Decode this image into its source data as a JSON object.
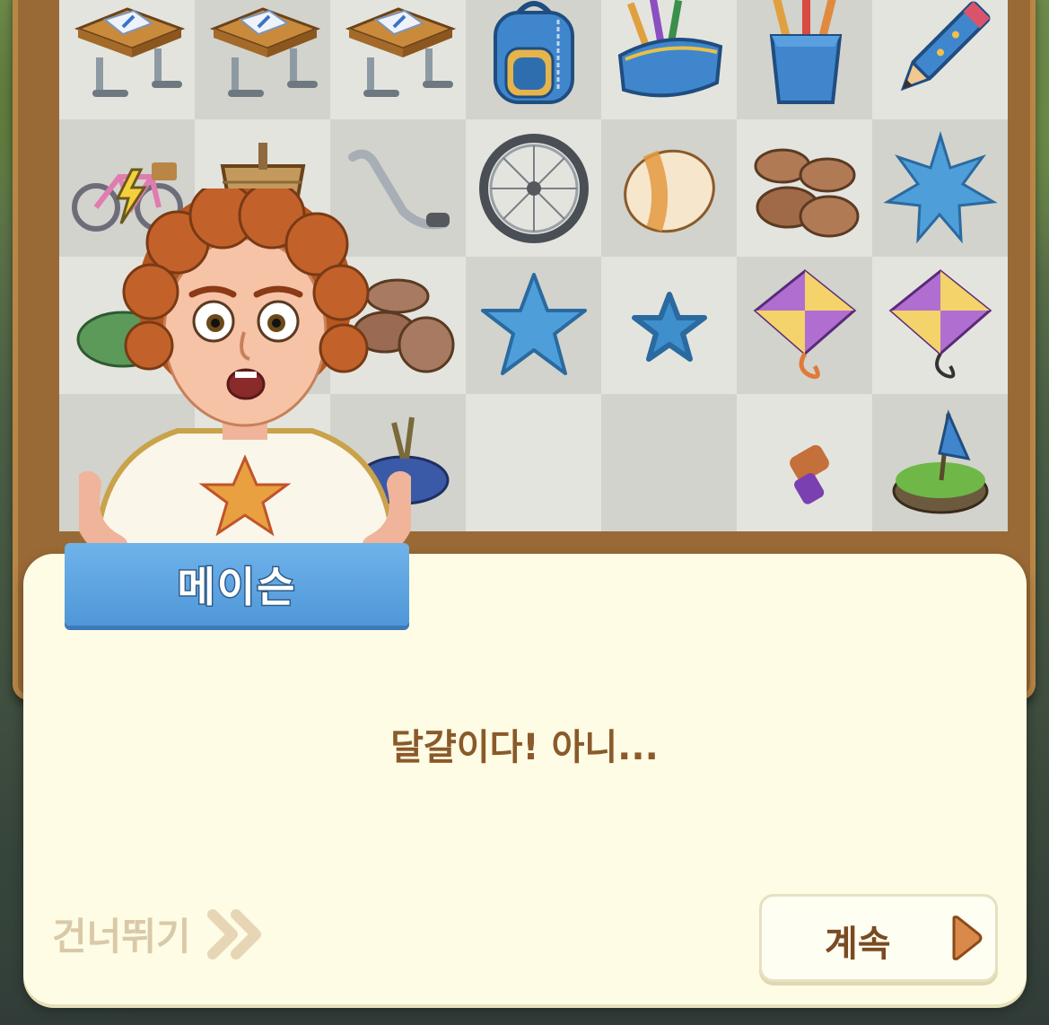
{
  "dialog": {
    "speaker": "메이슨",
    "text": "달걀이다! 아니...",
    "skip_label": "건너뛰기",
    "continue_label": "계속"
  },
  "board": {
    "rows": [
      [
        "desk-icon",
        "desk-icon",
        "desk-icon",
        "backpack-icon",
        "pencil-case-icon",
        "pencil-cup-icon",
        "pencil-icon"
      ],
      [
        "bicycle-icon",
        "bike-basket-icon",
        "handlebar-icon",
        "bike-wheel-icon",
        "egg-icon",
        "coins-pile-icon",
        "splat-star-icon"
      ],
      [
        "green-blob-icon",
        "",
        "coins-pile-icon",
        "star-icon",
        "small-star-icon",
        "kite-icon",
        "kite-icon"
      ],
      [
        "",
        "",
        "bird-nest-icon",
        "",
        "",
        "popsicle-icon",
        "flag-island-icon"
      ]
    ]
  },
  "colors": {
    "dialog_bg": "#fefce4",
    "nametag": "#4f97d8",
    "dialog_text": "#8a5a2b",
    "continue_arrow": "#d9894a"
  }
}
